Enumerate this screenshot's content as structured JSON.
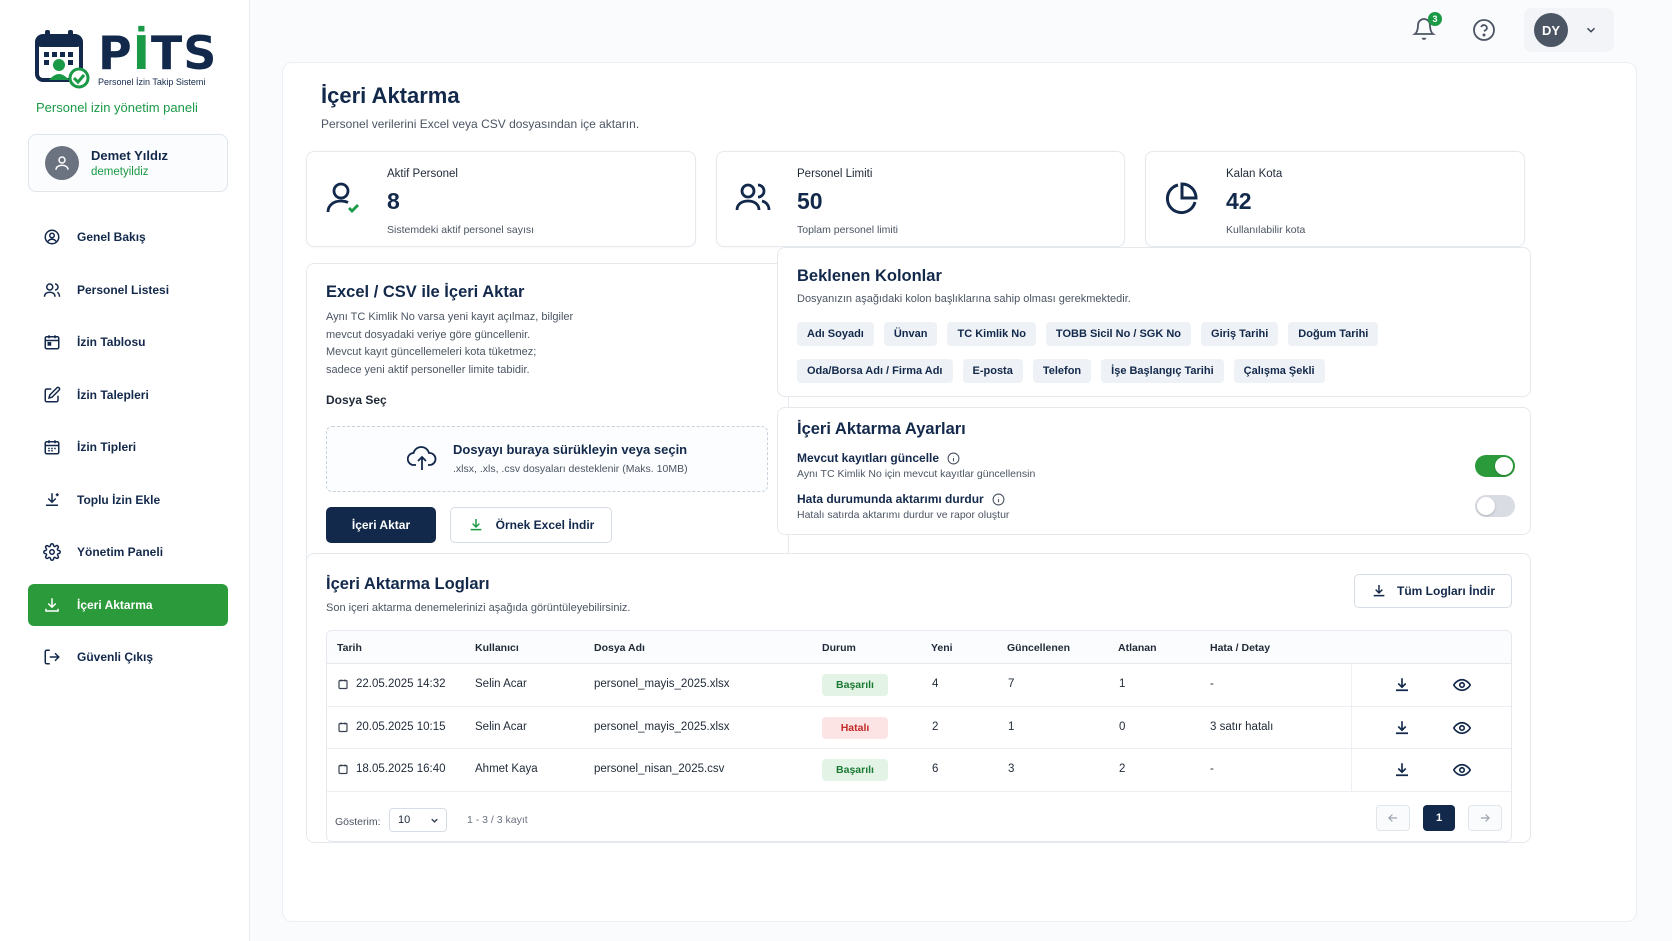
{
  "brand": {
    "name_main": "P",
    "name_accent": "İ",
    "name_rest": "TS",
    "subtitle": "Personel İzin Takip Sistemi",
    "tagline": "Personel izin yönetim paneli"
  },
  "user": {
    "name": "Demet Yıldız",
    "handle": "demetyildiz"
  },
  "nav": [
    {
      "label": "Genel Bakış",
      "icon": "dashboard-icon"
    },
    {
      "label": "Personel Listesi",
      "icon": "users-icon"
    },
    {
      "label": "İzin Tablosu",
      "icon": "calendar-icon"
    },
    {
      "label": "İzin Talepleri",
      "icon": "edit-icon"
    },
    {
      "label": "İzin Tipleri",
      "icon": "calendar-list-icon"
    },
    {
      "label": "Toplu İzin Ekle",
      "icon": "bulk-add-icon"
    },
    {
      "label": "Yönetim Paneli",
      "icon": "gear-icon"
    },
    {
      "label": "İçeri Aktarma",
      "icon": "import-icon",
      "active": true
    },
    {
      "label": "Güvenli Çıkış",
      "icon": "logout-icon"
    }
  ],
  "topbar": {
    "notification_count": "3",
    "profile_initials": "DY"
  },
  "page": {
    "title": "İçeri Aktarma",
    "subtitle": "Personel verilerini Excel veya CSV dosyasından içe aktarın."
  },
  "stats": [
    {
      "label": "Aktif Personel",
      "value": "8",
      "desc": "Sistemdeki aktif personel sayısı",
      "icon": "user-check-icon"
    },
    {
      "label": "Personel Limiti",
      "value": "50",
      "desc": "Toplam personel limiti",
      "icon": "users-icon"
    },
    {
      "label": "Kalan Kota",
      "value": "42",
      "desc": "Kullanılabilir kota",
      "icon": "pie-chart-icon"
    }
  ],
  "import_card": {
    "title": "Excel / CSV ile İçeri Aktar",
    "desc_lines": [
      "Aynı TC Kimlik No varsa yeni kayıt açılmaz, bilgiler",
      "mevcut dosyadaki veriye göre güncellenir.",
      "Mevcut kayıt güncellemeleri kota tüketmez;",
      "sadece yeni aktif personeller limite tabidir."
    ],
    "file_label": "Dosya Seç",
    "dropzone_title": "Dosyayı buraya sürükleyin veya seçin",
    "dropzone_sub": ".xlsx, .xls, .csv dosyaları desteklenir (Maks. 10MB)",
    "import_button": "İçeri Aktar",
    "sample_button": "Örnek Excel İndir"
  },
  "columns_card": {
    "title": "Beklenen Kolonlar",
    "subtitle": "Dosyanızın aşağıdaki kolon başlıklarına sahip olması gerekmektedir.",
    "columns": [
      "Adı Soyadı",
      "Ünvan",
      "TC Kimlik No",
      "TOBB Sicil No / SGK No",
      "Giriş Tarihi",
      "Doğum Tarihi",
      "Oda/Borsa Adı / Firma Adı",
      "E-posta",
      "Telefon",
      "İşe Başlangıç Tarihi",
      "Çalışma Şekli"
    ]
  },
  "settings_card": {
    "title": "İçeri Aktarma Ayarları",
    "settings": [
      {
        "title": "Mevcut kayıtları güncelle",
        "desc": "Aynı TC Kimlik No için mevcut kayıtlar güncellensin",
        "on": true
      },
      {
        "title": "Hata durumunda aktarımı durdur",
        "desc": "Hatalı satırda aktarımı durdur ve rapor oluştur",
        "on": false
      }
    ]
  },
  "logs": {
    "title": "İçeri Aktarma Logları",
    "subtitle": "Son içeri aktarma denemelerinizi aşağıda görüntüleyebilirsiniz.",
    "download_all": "Tüm Logları İndir",
    "headers": [
      "Tarih",
      "Kullanıcı",
      "Dosya Adı",
      "Durum",
      "Yeni",
      "Güncellenen",
      "Atlanan",
      "Hata / Detay"
    ],
    "rows": [
      {
        "date": "22.05.2025 14:32",
        "user": "Selin Acar",
        "file": "personel_mayis_2025.xlsx",
        "status": "Başarılı",
        "ok": true,
        "new": "4",
        "updated": "7",
        "skipped": "1",
        "detail": "-"
      },
      {
        "date": "20.05.2025 10:15",
        "user": "Selin Acar",
        "file": "personel_mayis_2025.xlsx",
        "status": "Hatalı",
        "ok": false,
        "new": "2",
        "updated": "1",
        "skipped": "0",
        "detail": "3 satır hatalı"
      },
      {
        "date": "18.05.2025 16:40",
        "user": "Ahmet Kaya",
        "file": "personel_nisan_2025.csv",
        "status": "Başarılı",
        "ok": true,
        "new": "6",
        "updated": "3",
        "skipped": "2",
        "detail": "-"
      }
    ],
    "pager": {
      "show_label": "Gösterim:",
      "page_size": "10",
      "range": "1 - 3 / 3 kayıt",
      "current_page": "1"
    }
  },
  "colors": {
    "navy": "#13294b",
    "green": "#2a9a3a",
    "error": "#c42b2b"
  }
}
